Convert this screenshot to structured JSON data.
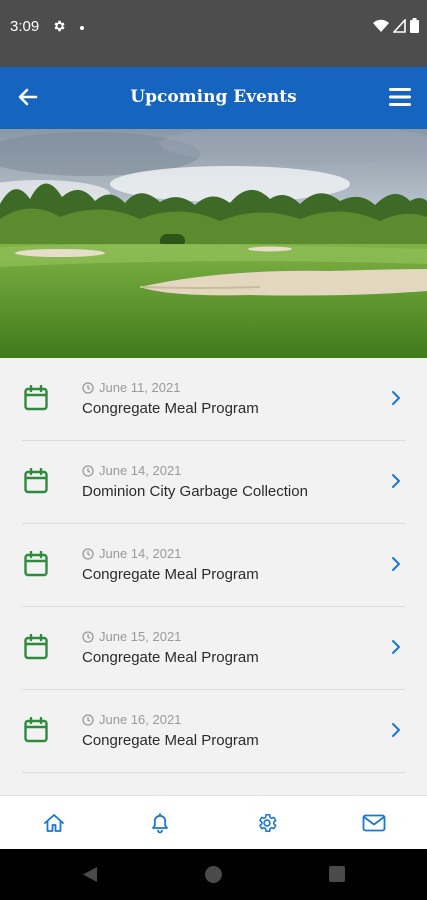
{
  "status_bar": {
    "time": "3:09"
  },
  "header": {
    "title": "Upcoming Events"
  },
  "events": [
    {
      "date": "June 11, 2021",
      "title": "Congregate Meal Program"
    },
    {
      "date": "June 14, 2021",
      "title": "Dominion City Garbage Collection"
    },
    {
      "date": "June 14, 2021",
      "title": "Congregate Meal Program"
    },
    {
      "date": "June 15, 2021",
      "title": "Congregate Meal Program"
    },
    {
      "date": "June 16, 2021",
      "title": "Congregate Meal Program"
    }
  ],
  "bottom_nav": [
    "home-icon",
    "bell-icon",
    "gear-icon",
    "mail-icon"
  ],
  "colors": {
    "header": "#1565c0",
    "accent": "#1976d2",
    "calendar": "#2e8b3e",
    "status_bar": "#4d4d4d"
  }
}
